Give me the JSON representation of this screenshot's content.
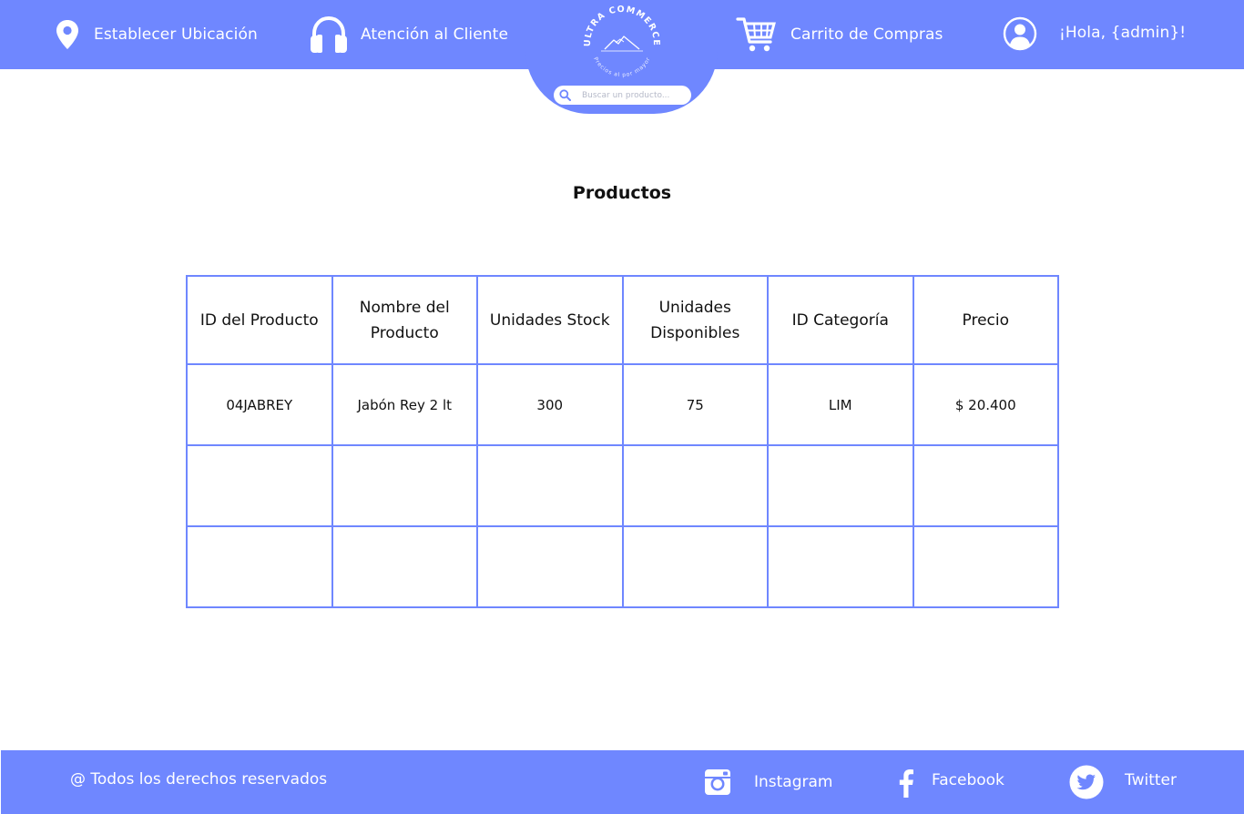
{
  "header": {
    "location_label": "Establecer Ubicación",
    "support_label": "Atención al Cliente",
    "cart_label": "Carrito de Compras",
    "greeting": "¡Hola, {admin}!",
    "logo_text": "ULTRA COMMERCE",
    "logo_tagline": "Precios al por mayor",
    "search": {
      "placeholder": "Buscar un producto..."
    }
  },
  "main": {
    "title": "Productos",
    "table": {
      "columns": [
        "ID del Producto",
        "Nombre del Producto",
        "Unidades Stock",
        "Unidades Disponibles",
        "ID Categoría",
        "Precio"
      ],
      "rows": [
        [
          "04JABREY",
          "Jabón Rey 2 lt",
          "300",
          "75",
          "LIM",
          "$ 20.400"
        ],
        [
          "",
          "",
          "",
          "",
          "",
          ""
        ],
        [
          "",
          "",
          "",
          "",
          "",
          ""
        ]
      ]
    }
  },
  "footer": {
    "copyright": "@ Todos los derechos reservados",
    "instagram": "Instagram",
    "facebook": "Facebook",
    "twitter": "Twitter"
  },
  "colors": {
    "primary": "#6f87ff",
    "text": "#111111",
    "background": "#ffffff"
  }
}
